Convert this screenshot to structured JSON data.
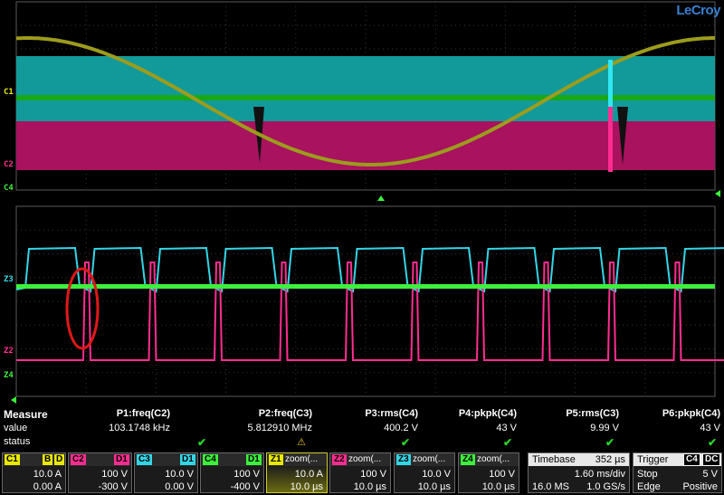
{
  "brand": "LeCroy",
  "colors": {
    "c1": "#e8e800",
    "c2": "#ff2d91",
    "c3": "#33d6e6",
    "c4": "#3cf03c",
    "cyan_fill": "#129a9a",
    "magenta_fill": "#a8125e",
    "olive": "#9c9c1c",
    "green": "#18a818"
  },
  "trace_labels": {
    "top": {
      "c1": "C1",
      "c2": "C2",
      "c4": "C4"
    },
    "bottom": {
      "z3": "Z3",
      "z2": "Z2",
      "z4": "Z4"
    }
  },
  "measure": {
    "title": "Measure",
    "value_label": "value",
    "status_label": "status",
    "params": [
      {
        "name": "P1:freq(C2)",
        "value": "103.1748 kHz",
        "status": "ok"
      },
      {
        "name": "P2:freq(C3)",
        "value": "5.812910 MHz",
        "status": "warn"
      },
      {
        "name": "P3:rms(C4)",
        "value": "400.2 V",
        "status": "ok"
      },
      {
        "name": "P4:pkpk(C4)",
        "value": "43 V",
        "status": "ok"
      },
      {
        "name": "P5:rms(C3)",
        "value": "9.99 V",
        "status": "ok"
      },
      {
        "name": "P6:pkpk(C4)",
        "value": "43 V",
        "status": "ok"
      }
    ],
    "ok_glyph": "✔",
    "warn_glyph": "⚠"
  },
  "channels": [
    {
      "id": "C1",
      "badges": [
        "B",
        "D"
      ],
      "scale": "10.0 A",
      "offset": "0.00 A"
    },
    {
      "id": "C2",
      "badges": [
        "D1"
      ],
      "scale": "100 V",
      "offset": "-300 V"
    },
    {
      "id": "C3",
      "badges": [
        "D1"
      ],
      "scale": "10.0 V",
      "offset": "0.00 V"
    },
    {
      "id": "C4",
      "badges": [
        "D1"
      ],
      "scale": "100 V",
      "offset": "-400 V"
    }
  ],
  "zooms": [
    {
      "id": "Z1",
      "name": "zoom(...",
      "scale": "10.0 A",
      "time": "10.0 µs"
    },
    {
      "id": "Z2",
      "name": "zoom(...",
      "scale": "100 V",
      "time": "10.0 µs"
    },
    {
      "id": "Z3",
      "name": "zoom(...",
      "scale": "10.0 V",
      "time": "10.0 µs"
    },
    {
      "id": "Z4",
      "name": "zoom(...",
      "scale": "100 V",
      "time": "10.0 µs"
    }
  ],
  "timebase": {
    "label": "Timebase",
    "delay": "352 µs",
    "scale": "1.60 ms/div",
    "samples": "16.0 MS",
    "rate": "1.0 GS/s"
  },
  "trigger": {
    "label": "Trigger",
    "source": "C4",
    "coupling": "DC",
    "mode": "Stop",
    "level": "5 V",
    "type": "Edge",
    "slope": "Positive"
  }
}
